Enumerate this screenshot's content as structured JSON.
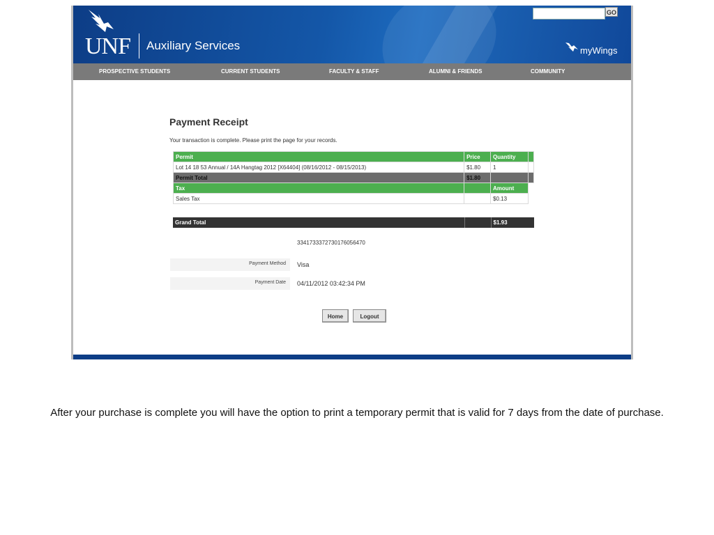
{
  "header": {
    "logo_text": "UNF",
    "site_title": "Auxiliary Services",
    "search": {
      "placeholder": "",
      "button_label": "GO"
    },
    "mywings_label": "myWings"
  },
  "nav": {
    "items": [
      {
        "label": "PROSPECTIVE STUDENTS"
      },
      {
        "label": "CURRENT STUDENTS"
      },
      {
        "label": "FACULTY & STAFF"
      },
      {
        "label": "ALUMNI & FRIENDS"
      },
      {
        "label": "COMMUNITY"
      }
    ]
  },
  "receipt": {
    "title": "Payment Receipt",
    "message": "Your transaction is complete. Please print the page for your records.",
    "permit_header": {
      "col1": "Permit",
      "col2": "Price",
      "col3": "Quantity"
    },
    "permit_row": {
      "description": "Lot 14 18 53 Annual / 14A Hangtag 2012 [X64404] (08/16/2012 - 08/15/2013)",
      "price": "$1.80",
      "quantity": "1"
    },
    "permit_total": {
      "label": "Permit Total",
      "value": "$1.80"
    },
    "tax_header": {
      "col1": "Tax",
      "col3": "Amount"
    },
    "tax_row": {
      "label": "Sales Tax",
      "amount": "$0.13"
    },
    "grand_total": {
      "label": "Grand Total",
      "value": "$1.93"
    },
    "confirmation_number": "3341733372730176056470",
    "payment_method": {
      "label": "Payment Method",
      "value": "Visa"
    },
    "payment_date": {
      "label": "Payment Date",
      "value": "04/11/2012 03:42:34 PM"
    },
    "buttons": {
      "home": "Home",
      "logout": "Logout"
    }
  },
  "caption": "After your purchase is complete you will have the option to print a temporary permit that is valid for 7 days from the date of purchase.",
  "colors": {
    "header_blue": "#1457a8",
    "nav_gray": "#7a7a7a",
    "table_green": "#4caf4f",
    "grand_total_dark": "#333333"
  }
}
